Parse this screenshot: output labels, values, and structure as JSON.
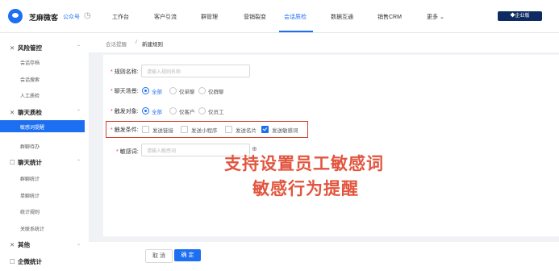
{
  "topbar": {
    "brand": "芝麻微客",
    "account": "公众号",
    "tabs": [
      "工作台",
      "客户引流",
      "群管理",
      "营销裂变",
      "会话质检",
      "数据互通",
      "销售CRM",
      "更多 ⌄"
    ],
    "active_tab_index": 4,
    "badge": "◆企业版"
  },
  "sidebar": {
    "groups": [
      {
        "icon": "✕",
        "label": "风险管控",
        "caret": "⌃",
        "items": [
          "会话存档",
          "会话搜索",
          "人工质检"
        ]
      },
      {
        "icon": "✕",
        "label": "聊天质检",
        "caret": "⌃",
        "items": [
          "敏感词提醒",
          "群聊待办"
        ]
      },
      {
        "icon": "☐",
        "label": "聊天统计",
        "caret": "⌃",
        "items": [
          "群聊统计",
          "单聊统计",
          "统计规则",
          "关联系统计"
        ]
      },
      {
        "icon": "✕",
        "label": "其他",
        "caret": "⌄",
        "items": []
      },
      {
        "icon": "☐",
        "label": "企微统计",
        "caret": "",
        "items": []
      }
    ],
    "active_item": "敏感词提醒"
  },
  "breadcrumb": {
    "parent": "会话提醒",
    "sep": "/",
    "current": "新建规则"
  },
  "form": {
    "rule_name_label": "规则名称:",
    "rule_name_placeholder": "请输入规则名称",
    "scene_label": "聊天场景:",
    "scene_options": [
      "全部",
      "仅单聊",
      "仅群聊"
    ],
    "target_label": "触发对象:",
    "target_options": [
      "全部",
      "仅客户",
      "仅员工"
    ],
    "trigger_label": "触发条件:",
    "trigger_options": [
      "发送链接",
      "发送小程序",
      "发送名片",
      "发送敏感词"
    ],
    "trigger_checked": [
      false,
      false,
      false,
      true
    ],
    "sensitive_label": "敏感词:",
    "sensitive_placeholder": "请输入敏感词",
    "add_icon": "⊕"
  },
  "annotation": {
    "line1": "支持设置员工敏感词",
    "line2": "敏感行为提醒",
    "color": "#e2553f"
  },
  "footer": {
    "cancel": "取 消",
    "confirm": "确 定"
  },
  "colors": {
    "accent": "#1d6ff2",
    "highlight": "#d43f2d"
  }
}
